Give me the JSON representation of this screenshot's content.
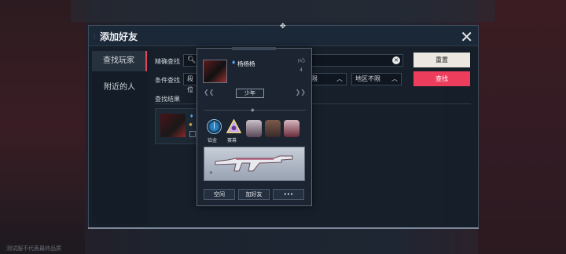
{
  "dialog": {
    "title": "添加好友",
    "close_label": "✕"
  },
  "sidebar": {
    "items": [
      {
        "label": "查找玩家",
        "active": true
      },
      {
        "label": "附近的人",
        "active": false
      }
    ]
  },
  "search": {
    "exact_label": "精确查找",
    "condition_label": "条件查找",
    "rank_field_value": "段位",
    "filter_a_value": "不限",
    "filter_b_value": "地区不限",
    "results_label": "查找结果",
    "reset_button": "重置",
    "search_button": "查找"
  },
  "popup": {
    "player_name": "杨杨杨",
    "likes": "4",
    "rank_tag": "少年",
    "badges": [
      {
        "label": "铂金"
      },
      {
        "label": "赛幕"
      }
    ],
    "buttons": {
      "space": "空间",
      "add_friend": "加好友",
      "more": "•••"
    }
  },
  "background": {
    "bottom_note": "测试服不代表最终品质"
  },
  "colors": {
    "accent": "#ec3d5c",
    "reset_bg": "#ece7e0"
  }
}
